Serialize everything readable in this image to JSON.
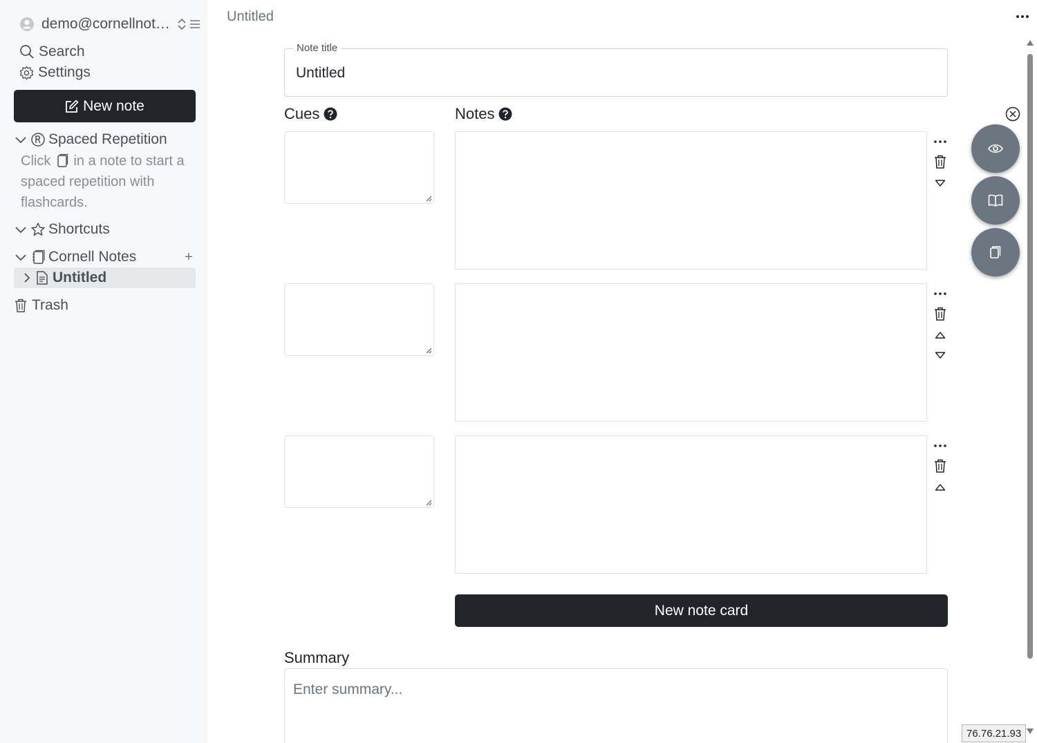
{
  "sidebar": {
    "account_email": "demo@cornellnotes.com",
    "search_label": "Search",
    "settings_label": "Settings",
    "new_note_label": "New note",
    "spaced_repetition": {
      "label": "Spaced Repetition",
      "help_before": "Click",
      "help_after": "in a note to start a spaced repetition with flashcards."
    },
    "shortcuts_label": "Shortcuts",
    "folder": {
      "label": "Cornell Notes",
      "add_label": "+",
      "items": [
        {
          "label": "Untitled"
        }
      ]
    },
    "trash_label": "Trash"
  },
  "main": {
    "doc_title": "Untitled",
    "note_title_legend": "Note title",
    "note_title_value": "Untitled",
    "cues_label": "Cues",
    "notes_label": "Notes",
    "new_card_label": "New note card",
    "summary_label": "Summary",
    "summary_placeholder": "Enter summary..."
  },
  "ip_badge": "76.76.21.93",
  "colors": {
    "dark_button": "#212529",
    "fab": "#6c7680",
    "sidebar_bg": "#f7f8f9"
  }
}
